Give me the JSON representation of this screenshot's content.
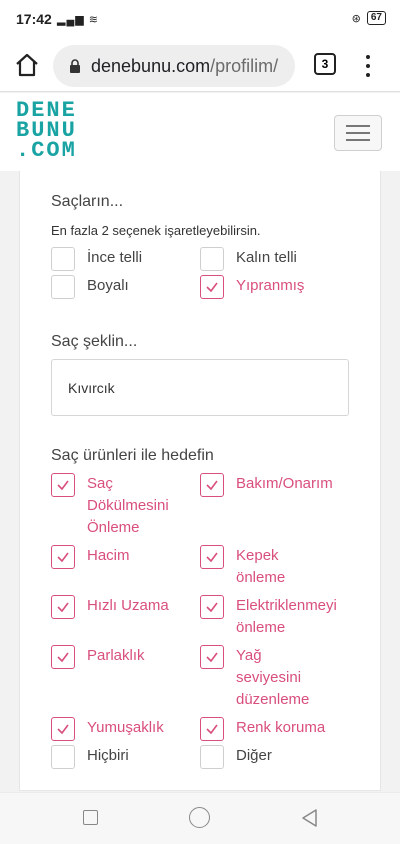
{
  "status": {
    "time": "17:42",
    "network": "Vo LTE",
    "battery": "67"
  },
  "browser": {
    "domain": "denebunu.com",
    "path": "/profilim/",
    "tab_count": "3"
  },
  "site": {
    "logo_lines": [
      "DENE",
      "BUNU",
      ".COM"
    ]
  },
  "hair": {
    "title": "Saçların...",
    "hint": "En fazla 2 seçenek işaretleyebilirsin.",
    "options": [
      {
        "label": "İnce telli",
        "checked": false
      },
      {
        "label": "Kalın telli",
        "checked": false
      },
      {
        "label": "Boyalı",
        "checked": false
      },
      {
        "label": "Yıpranmış",
        "checked": true
      }
    ]
  },
  "shape": {
    "title": "Saç şeklin...",
    "value": "Kıvırcık"
  },
  "goals": {
    "title": "Saç ürünleri ile hedefin",
    "options": [
      {
        "label": "Saç Dökülmesini Önleme",
        "checked": true
      },
      {
        "label": "Bakım/Onarım",
        "checked": true
      },
      {
        "label": "Hacim",
        "checked": true
      },
      {
        "label": "Kepek önleme",
        "checked": true
      },
      {
        "label": "Hızlı Uzama",
        "checked": true
      },
      {
        "label": "Elektriklenmeyi önleme",
        "checked": true
      },
      {
        "label": "Parlaklık",
        "checked": true
      },
      {
        "label": "Yağ seviyesini düzenleme",
        "checked": true
      },
      {
        "label": "Yumuşaklık",
        "checked": true
      },
      {
        "label": "Renk koruma",
        "checked": true
      },
      {
        "label": "Hiçbiri",
        "checked": false
      },
      {
        "label": "Diğer",
        "checked": false
      }
    ]
  },
  "colors": {
    "accent": "#d94f7c",
    "logo": "#1aa3a3"
  }
}
